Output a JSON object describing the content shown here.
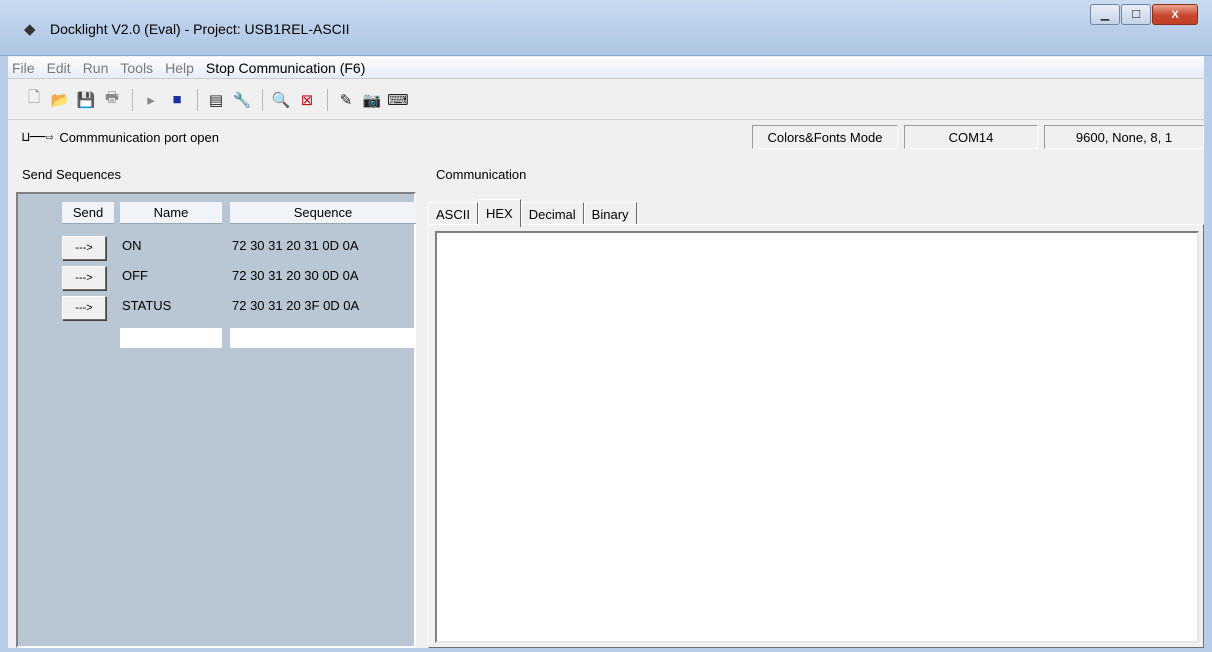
{
  "window": {
    "title": "Docklight V2.0 (Eval) - Project: USB1REL-ASCII",
    "minimize_glyph": "▁",
    "maximize_glyph": "☐",
    "close_glyph": "X"
  },
  "menu": {
    "items": [
      "File",
      "Edit",
      "Run",
      "Tools",
      "Help"
    ],
    "stop_label": "Stop Communication  (F6)"
  },
  "toolbar": {
    "icons": [
      "new-file",
      "open-folder",
      "save",
      "print",
      "run",
      "stop",
      "properties",
      "settings",
      "find",
      "clear",
      "edit-script",
      "snapshot",
      "keyboard"
    ]
  },
  "status": {
    "port_glyph": "⊔──⇨",
    "port_text": "Commmunication port open",
    "mode": "Colors&Fonts Mode",
    "com": "COM14",
    "settings": "9600, None, 8, 1"
  },
  "send_sequences": {
    "label": "Send Sequences",
    "headers": {
      "send": "Send",
      "name": "Name",
      "sequence": "Sequence"
    },
    "button_label": "--->",
    "rows": [
      {
        "name": "ON",
        "sequence": "72 30 31 20 31 0D 0A"
      },
      {
        "name": "OFF",
        "sequence": "72 30 31 20 30 0D 0A"
      },
      {
        "name": "STATUS",
        "sequence": "72 30 31 20 3F 0D 0A"
      }
    ]
  },
  "communication": {
    "label": "Communication",
    "tabs": [
      "ASCII",
      "HEX",
      "Decimal",
      "Binary"
    ],
    "selected_tab": "HEX"
  }
}
